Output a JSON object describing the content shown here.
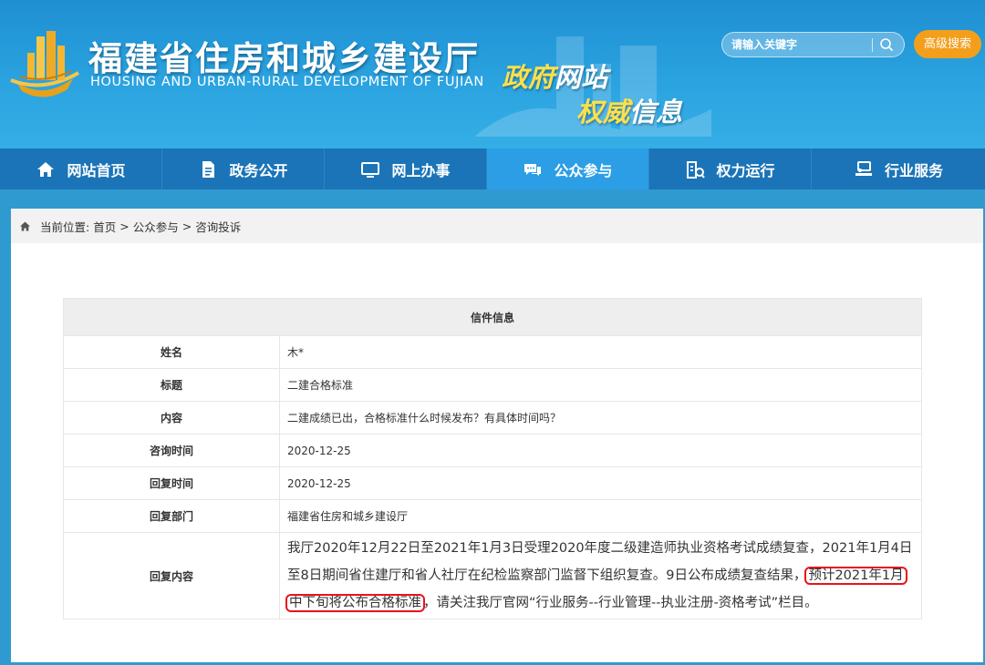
{
  "header": {
    "site_title_cn": "福建省住房和城乡建设厅",
    "site_title_en": "HOUSING AND URBAN-RURAL DEVELOPMENT OF FUJIAN",
    "slogan_line1_a": "政府",
    "slogan_line1_b": "网站",
    "slogan_line2_a": "权威",
    "slogan_line2_b": "信息",
    "search_placeholder": "请输入关键字",
    "advanced_search_label": "高级搜索",
    "colors": {
      "bg": "#2aa3e0",
      "accent_gold": "#ffe04a",
      "button_orange": "#f49f1c"
    }
  },
  "nav": {
    "items": [
      {
        "label": "网站首页",
        "icon": "home-icon"
      },
      {
        "label": "政务公开",
        "icon": "document-icon"
      },
      {
        "label": "网上办事",
        "icon": "monitor-icon"
      },
      {
        "label": "公众参与",
        "icon": "chat-icon"
      },
      {
        "label": "权力运行",
        "icon": "building-icon"
      },
      {
        "label": "行业服务",
        "icon": "service-desk-icon"
      }
    ],
    "active": "公众参与",
    "colors": {
      "bar": "#1b74b7",
      "active": "#2b9ee6"
    }
  },
  "breadcrumb": {
    "prefix": "当前位置:",
    "home": "首页",
    "sep": ">",
    "section": "公众参与",
    "page": "咨询投诉"
  },
  "letter": {
    "title": "信件信息",
    "rows": [
      {
        "label": "姓名",
        "value": "木*"
      },
      {
        "label": "标题",
        "value": "二建合格标准"
      },
      {
        "label": "内容",
        "value": "二建成绩已出，合格标准什么时候发布？有具体时间吗？"
      },
      {
        "label": "咨询时间",
        "value": "2020-12-25"
      },
      {
        "label": "回复时间",
        "value": "2020-12-25"
      },
      {
        "label": "回复部门",
        "value": "福建省住房和城乡建设厅"
      }
    ],
    "reply_label": "回复内容",
    "reply": {
      "part1": "我厅2020年12月22日至2021年1月3日受理2020年度二级建造师执业资格考试成绩复查，2021年1月4日至8日期间省住建厅和省人社厅在纪检监察部门监督下组织复查。9日公布成绩复查结果，",
      "highlight1": "预计2021年1月",
      "highlight2": "中下旬将公布合格标准",
      "part2": "，请关注我厅官网“行业服务--行业管理--执业注册-资格考试”栏目。",
      "highlight_color": "#e8131b"
    }
  }
}
